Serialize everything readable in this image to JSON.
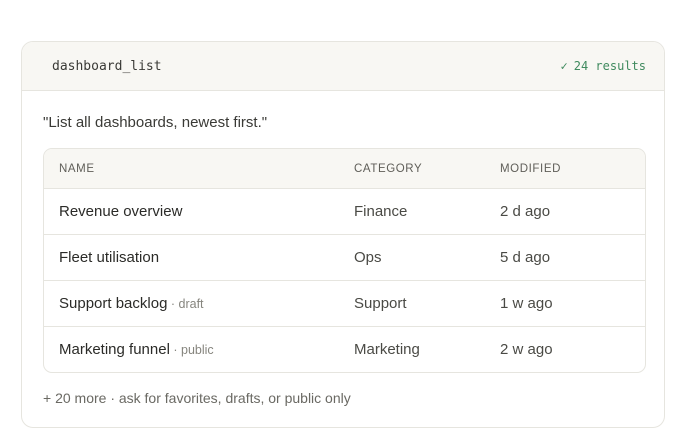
{
  "tool": {
    "name": "dashboard_list",
    "status_icon": "✓",
    "status_text": "24 results",
    "status_color": "#3f8a5e"
  },
  "query": "\"List all dashboards, newest first.\"",
  "table": {
    "columns": [
      "NAME",
      "CATEGORY",
      "MODIFIED"
    ],
    "rows": [
      {
        "name": "Revenue overview",
        "tag": "",
        "category": "Finance",
        "modified": "2 d ago"
      },
      {
        "name": "Fleet utilisation",
        "tag": "",
        "category": "Ops",
        "modified": "5 d ago"
      },
      {
        "name": "Support backlog",
        "tag": " · draft",
        "category": "Support",
        "modified": "1 w ago"
      },
      {
        "name": "Marketing funnel",
        "tag": " · public",
        "category": "Marketing",
        "modified": "2 w ago"
      }
    ]
  },
  "footer": "+ 20 more · ask for favorites, drafts, or public only"
}
